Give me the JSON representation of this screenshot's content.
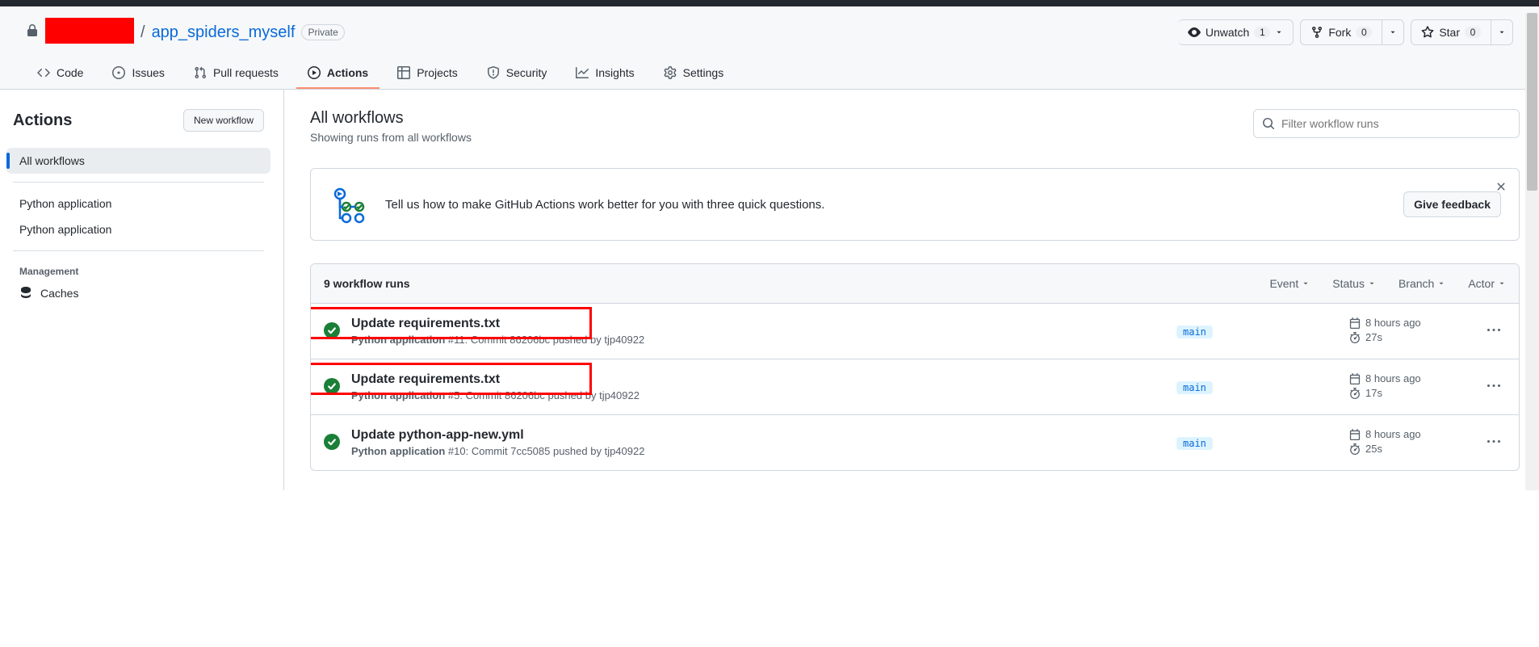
{
  "repo": {
    "owner_redacted": true,
    "name": "app_spiders_myself",
    "visibility": "Private"
  },
  "repo_actions": {
    "watch_label": "Unwatch",
    "watch_count": "1",
    "fork_label": "Fork",
    "fork_count": "0",
    "star_label": "Star",
    "star_count": "0"
  },
  "tabs": {
    "code": "Code",
    "issues": "Issues",
    "pulls": "Pull requests",
    "actions": "Actions",
    "projects": "Projects",
    "security": "Security",
    "insights": "Insights",
    "settings": "Settings"
  },
  "sidebar": {
    "title": "Actions",
    "new_workflow": "New workflow",
    "items": [
      {
        "label": "All workflows",
        "active": true
      },
      {
        "label": "Python application",
        "active": false
      },
      {
        "label": "Python application",
        "active": false
      }
    ],
    "management_header": "Management",
    "caches": "Caches"
  },
  "main": {
    "title": "All workflows",
    "subtitle": "Showing runs from all workflows",
    "search_placeholder": "Filter workflow runs"
  },
  "banner": {
    "text": "Tell us how to make GitHub Actions work better for you with three quick questions.",
    "button": "Give feedback"
  },
  "runs_header": {
    "count_text": "9 workflow runs",
    "filters": {
      "event": "Event",
      "status": "Status",
      "branch": "Branch",
      "actor": "Actor"
    }
  },
  "runs": [
    {
      "title": "Update requirements.txt",
      "workflow": "Python application",
      "run_number": "#11",
      "commit_text": ": Commit 86206bc pushed by tjp40922",
      "branch": "main",
      "time": "8 hours ago",
      "duration": "27s",
      "highlight": true
    },
    {
      "title": "Update requirements.txt",
      "workflow": "Python application",
      "run_number": "#5",
      "commit_text": ": Commit 86206bc pushed by tjp40922",
      "branch": "main",
      "time": "8 hours ago",
      "duration": "17s",
      "highlight": true
    },
    {
      "title": "Update python-app-new.yml",
      "workflow": "Python application",
      "run_number": "#10",
      "commit_text": ": Commit 7cc5085 pushed by tjp40922",
      "branch": "main",
      "time": "8 hours ago",
      "duration": "25s",
      "highlight": false
    }
  ]
}
